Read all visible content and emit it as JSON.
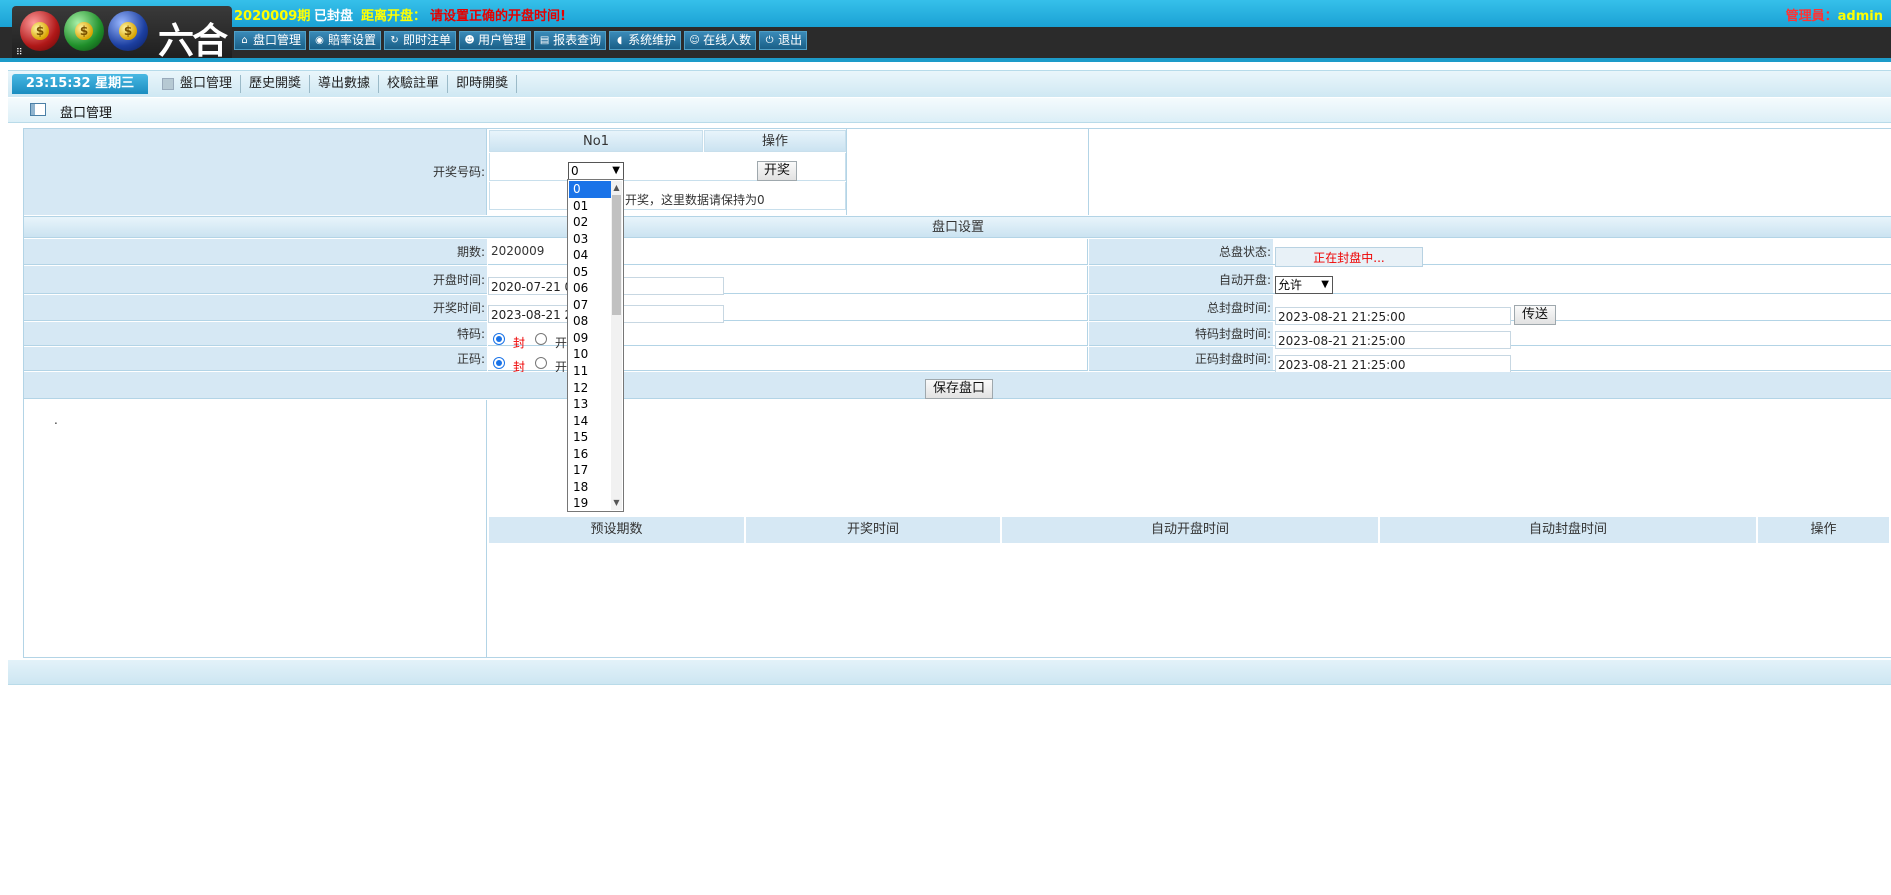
{
  "header": {
    "logo_text": "六合",
    "logo_dots": "⠿",
    "coin_symbol": "$",
    "period": "2020009期",
    "status": "已封盘",
    "countdown_label": "距离开盘：",
    "countdown_message": "请设置正确的开盘时间!",
    "admin_label": "管理員：",
    "admin_name": "admin",
    "nav": [
      {
        "label": "盘口管理",
        "icon": "home-icon"
      },
      {
        "label": "賠率设置",
        "icon": "circle-dot-icon"
      },
      {
        "label": "即时注单",
        "icon": "refresh-icon"
      },
      {
        "label": "用户管理",
        "icon": "user-icon"
      },
      {
        "label": "报表查询",
        "icon": "report-icon"
      },
      {
        "label": "系统维护",
        "icon": "broadcast-icon"
      },
      {
        "label": "在线人数",
        "icon": "smile-icon"
      },
      {
        "label": "退出",
        "icon": "power-icon"
      }
    ]
  },
  "tabbar": {
    "clock": "23:15:32 星期三",
    "tabs": [
      "盤口管理",
      "歷史開獎",
      "導出數據",
      "校驗註單",
      "即時開獎"
    ]
  },
  "page_title": "盘口管理",
  "draw": {
    "col_no": "No1",
    "col_action": "操作",
    "label": "开奖号码:",
    "selected": "0",
    "draw_button": "开奖",
    "note": "开奖，这里数据请保持为0",
    "options": [
      "0",
      "01",
      "02",
      "03",
      "04",
      "05",
      "06",
      "07",
      "08",
      "09",
      "10",
      "11",
      "12",
      "13",
      "14",
      "15",
      "16",
      "17",
      "18",
      "19"
    ]
  },
  "settings": {
    "section_title": "盘口设置",
    "period_label": "期数:",
    "period_value": "2020009",
    "open_time_label": "开盘时间:",
    "open_time_value": "2020-07-21 0",
    "draw_time_label": "开奖时间:",
    "draw_time_value": "2023-08-21 2",
    "special_label": "特码:",
    "normal_label": "正码:",
    "radio_closed": "封",
    "radio_open": "开",
    "status_label": "总盘状态:",
    "status_value": "正在封盘中...",
    "auto_open_label": "自动开盘:",
    "auto_open_value": "允许",
    "total_close_label": "总封盘时间:",
    "total_close_value": "2023-08-21 21:25:00",
    "send_button": "传送",
    "special_close_label": "特码封盘时间:",
    "special_close_value": "2023-08-21 21:25:00",
    "normal_close_label": "正码封盘时间:",
    "normal_close_value": "2023-08-21 21:25:00",
    "save_button": "保存盘口"
  },
  "preset": {
    "dot": ".",
    "columns": [
      "预设期数",
      "开奖时间",
      "自动开盘时间",
      "自动封盘时间",
      "操作"
    ]
  },
  "colors": {
    "header_blue": "#1aa1d4",
    "cell_blue": "#d6e8f4",
    "alert_red": "#e50000",
    "highlight_yellow": "#ffff00"
  }
}
